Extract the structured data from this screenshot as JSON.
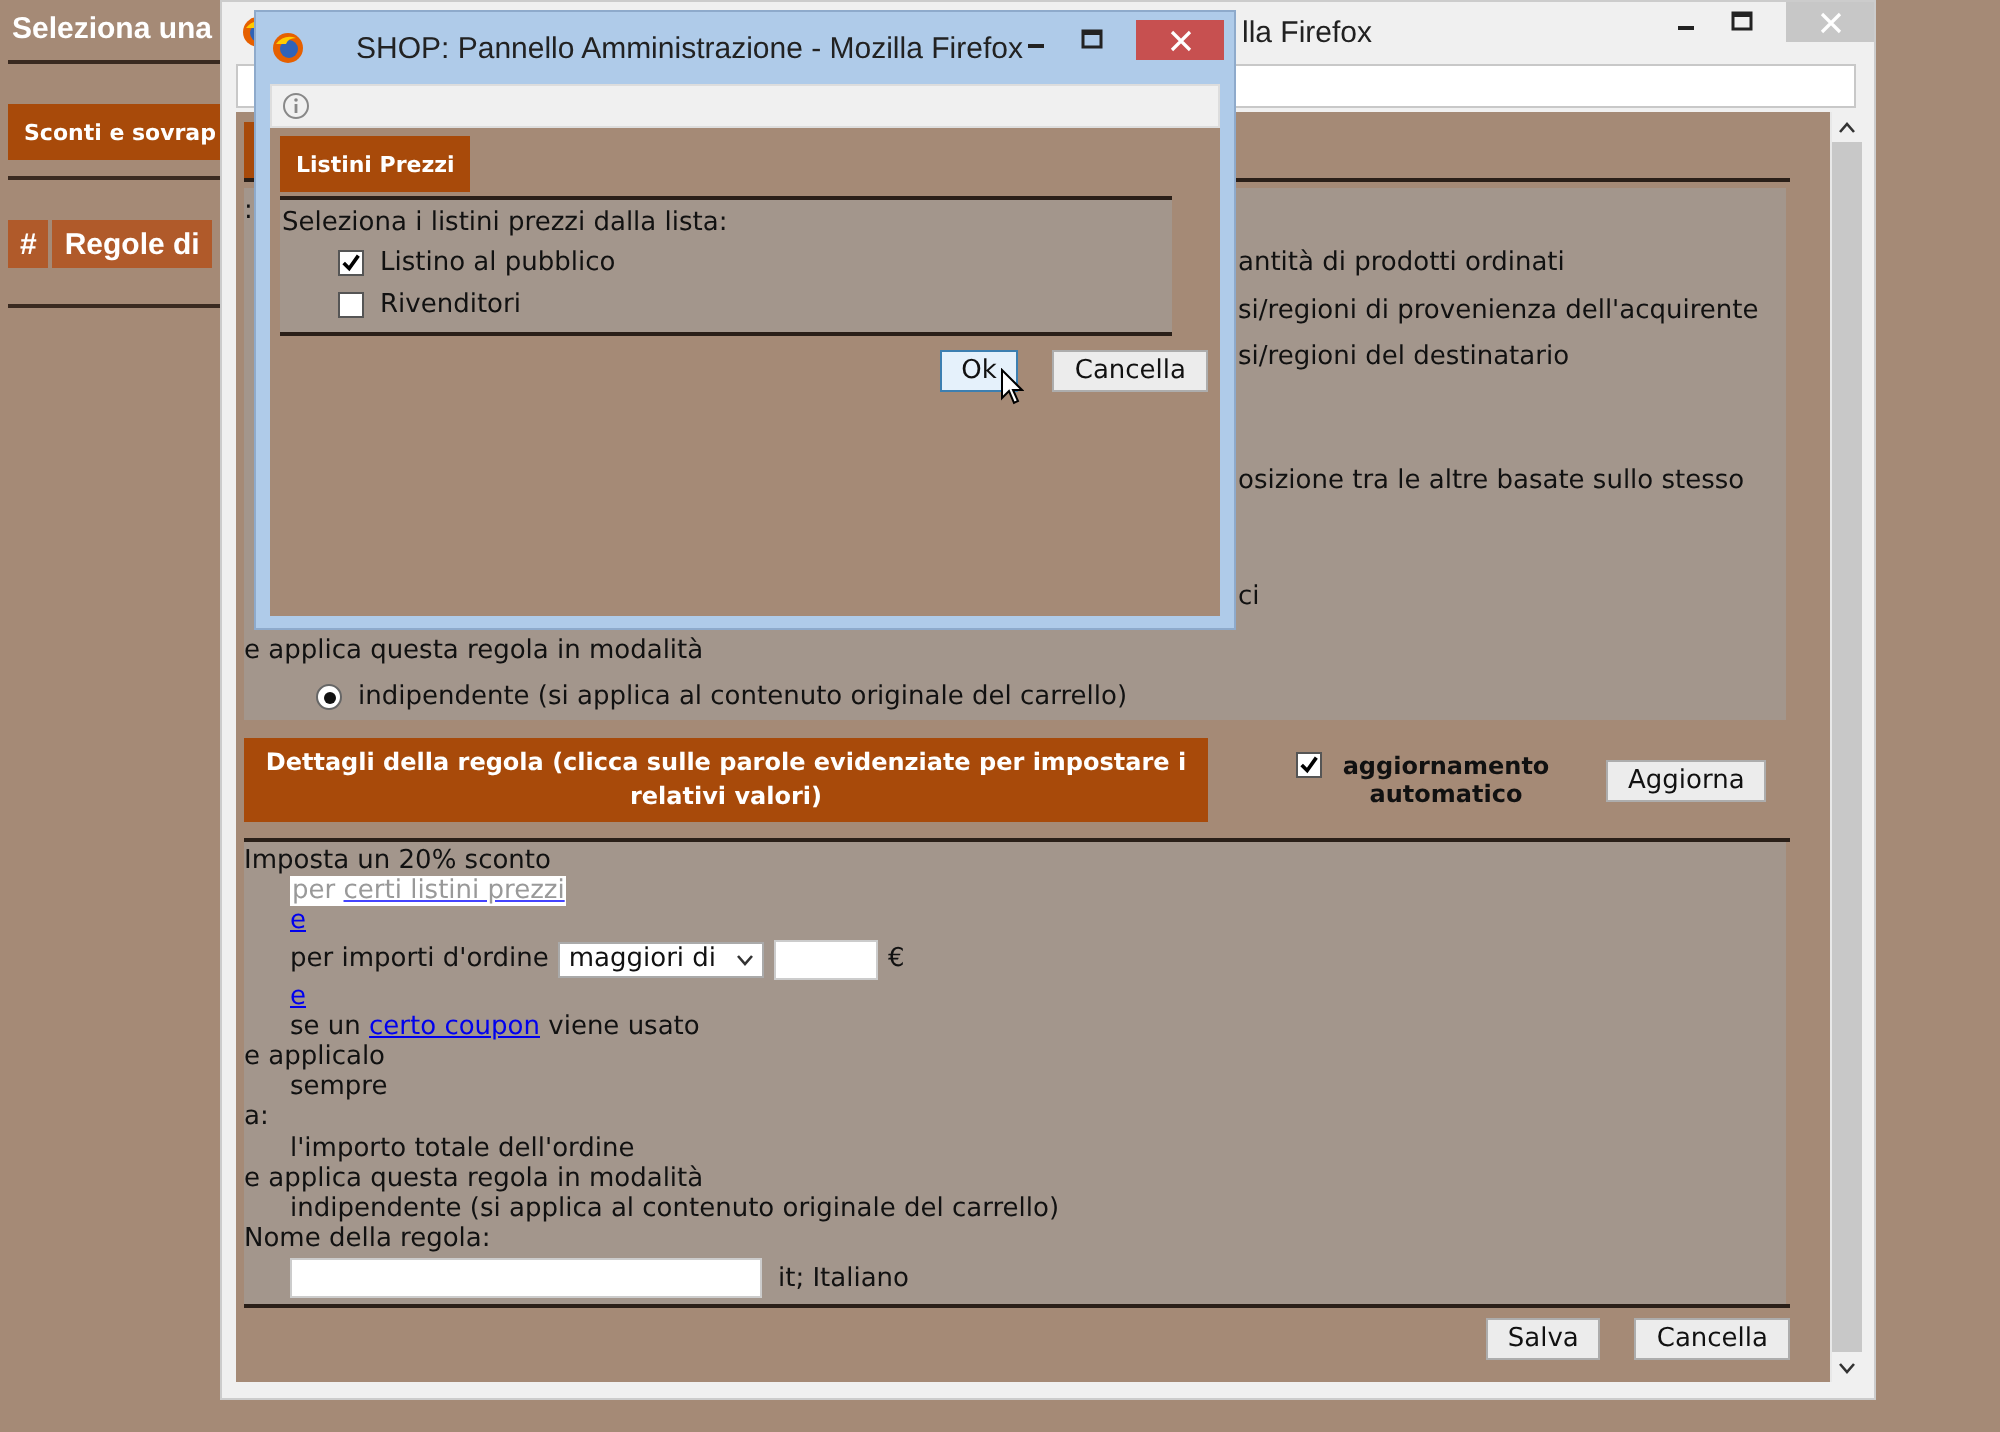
{
  "background_page": {
    "title": "Seleziona una",
    "button": "Sconti e sovrap",
    "table_columns": [
      "#",
      "Regole di"
    ]
  },
  "browser": {
    "title": "lla Firefox",
    "panel_lines": [
      ":",
      "antità di prodotti ordinati",
      "si/regioni di provenienza dell'acquirente",
      "si/regioni del destinatario",
      "osizione tra le altre basate sullo stesso",
      "ci"
    ],
    "mode_label": "e applica questa regola in modalità",
    "mode_option": {
      "label": "indipendente (si applica al contenuto originale del carrello)",
      "selected": true
    },
    "details_header": "Dettagli della regola (clicca sulle parole evidenziate per impostare i relativi valori)",
    "auto_update": {
      "label": "aggiornamento automatico",
      "checked": true
    },
    "update_button": "Aggiorna",
    "rule_lines": [
      {
        "kind": "text",
        "text": "Imposta un 20% sconto",
        "children": [
          {
            "kind": "highlight",
            "prefix": "per",
            "link": "certi listini prezzi"
          },
          {
            "kind": "link",
            "text": "e"
          },
          {
            "kind": "amount",
            "label": "per importi d'ordine",
            "select": "maggiori di",
            "currency": "€"
          },
          {
            "kind": "link",
            "text": "e"
          },
          {
            "kind": "sentence",
            "before": "se un",
            "link": "certo coupon",
            "after": "viene usato"
          }
        ]
      },
      {
        "kind": "text",
        "text": "e applicalo",
        "children": [
          {
            "kind": "text",
            "text": "sempre"
          }
        ]
      },
      {
        "kind": "text",
        "text": "a:",
        "children": [
          {
            "kind": "text",
            "text": "l'importo totale dell'ordine"
          }
        ]
      },
      {
        "kind": "text",
        "text": "e applica questa regola in modalità",
        "children": [
          {
            "kind": "text",
            "text": "indipendente (si applica al contenuto originale del carrello)"
          }
        ]
      },
      {
        "kind": "text",
        "text": "Nome della regola:",
        "children": [
          {
            "kind": "name",
            "language": "it; Italiano"
          }
        ]
      }
    ],
    "save_button": "Salva",
    "cancel_button": "Cancella"
  },
  "popup": {
    "title": "SHOP: Pannello Amministrazione - Mozilla Firefox",
    "tab": "Listini Prezzi",
    "prompt": "Seleziona i listini prezzi dalla lista:",
    "price_lists": [
      {
        "label": "Listino al pubblico",
        "checked": true
      },
      {
        "label": "Rivenditori",
        "checked": false
      }
    ],
    "ok_button": "Ok",
    "cancel_button": "Cancella"
  }
}
